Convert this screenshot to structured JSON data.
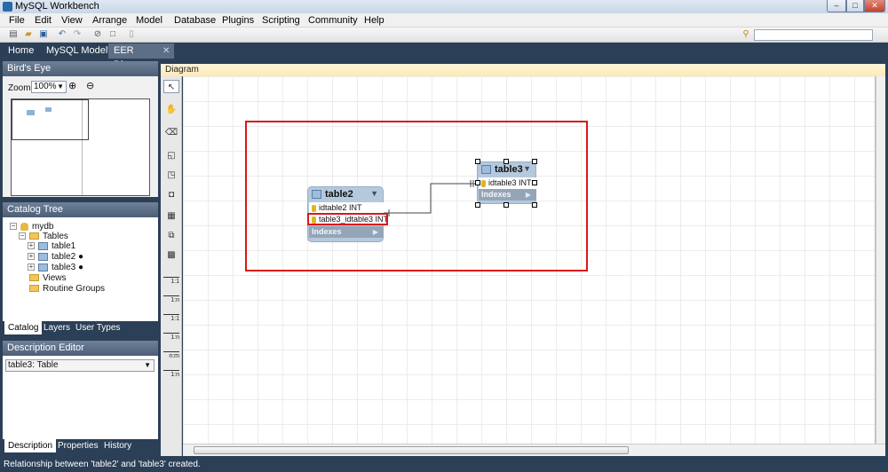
{
  "window": {
    "title": "MySQL Workbench",
    "min": "–",
    "max": "□",
    "close": "✕"
  },
  "menu": [
    "File",
    "Edit",
    "View",
    "Arrange",
    "Model",
    "Database",
    "Plugins",
    "Scripting",
    "Community",
    "Help"
  ],
  "search": {
    "value": ""
  },
  "tabs": {
    "home": "Home",
    "model": "MySQL Model*",
    "eer": "EER Diagram",
    "close": "✕"
  },
  "birds_eye": {
    "header": "Bird's Eye",
    "zoom_label": "Zoom:",
    "zoom_value": "100%"
  },
  "catalog": {
    "header": "Catalog Tree",
    "schema": "mydb",
    "tables_folder": "Tables",
    "tables": [
      "table1",
      "table2 ●",
      "table3 ●"
    ],
    "views": "Views",
    "routine_groups": "Routine Groups",
    "tabs": [
      "Catalog",
      "Layers",
      "User Types"
    ]
  },
  "description": {
    "header": "Description Editor",
    "selected": "table3: Table",
    "tabs": [
      "Description",
      "Properties",
      "History"
    ]
  },
  "diagram": {
    "header": "Diagram",
    "rel_tools": [
      "1:1",
      "1:n",
      "1:1",
      "1:n",
      "n:m",
      "1:n"
    ],
    "table2": {
      "name": "table2",
      "columns": [
        "idtable2 INT",
        "table3_idtable3 INT"
      ],
      "indexes": "Indexes"
    },
    "table3": {
      "name": "table3",
      "columns": [
        "idtable3 INT"
      ],
      "indexes": "Indexes"
    }
  },
  "status": "Relationship between 'table2' and 'table3' created."
}
